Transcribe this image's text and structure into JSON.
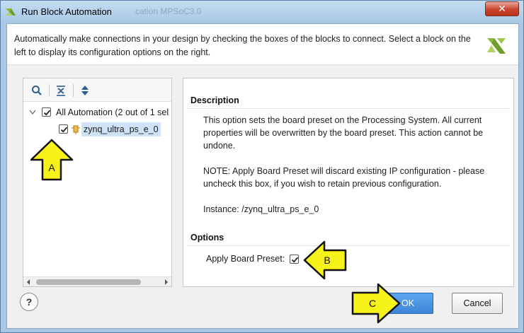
{
  "window": {
    "title": "Run Block Automation",
    "ghost_title": "cation MPSoC3.0",
    "close_label": "✕"
  },
  "header": {
    "text": "Automatically make connections in your design by checking the boxes of the blocks to connect. Select a block on the left to display its configuration options on the right."
  },
  "tree": {
    "root_label": "All Automation (2 out of 1 sel",
    "root_checked": true,
    "child_label": "zynq_ultra_ps_e_0",
    "child_checked": true
  },
  "toolbar": {
    "icons": [
      "search-icon",
      "collapse-all-icon",
      "expand-all-icon"
    ]
  },
  "details": {
    "description_title": "Description",
    "description_line1": "This option sets the board preset on the Processing System. All current properties will be overwritten by the board preset. This action cannot be undone.",
    "description_line2": "NOTE: Apply Board Preset will discard existing IP configuration - please uncheck this box, if you wish to retain previous configuration.",
    "instance": "Instance: /zynq_ultra_ps_e_0",
    "options_title": "Options",
    "apply_board_preset_label": "Apply Board Preset:",
    "apply_board_preset_checked": true
  },
  "footer": {
    "help_label": "?",
    "ok_label": "OK",
    "cancel_label": "Cancel"
  },
  "callouts": {
    "a": "A",
    "b": "B",
    "c": "C",
    "color": "#f7f21a"
  }
}
